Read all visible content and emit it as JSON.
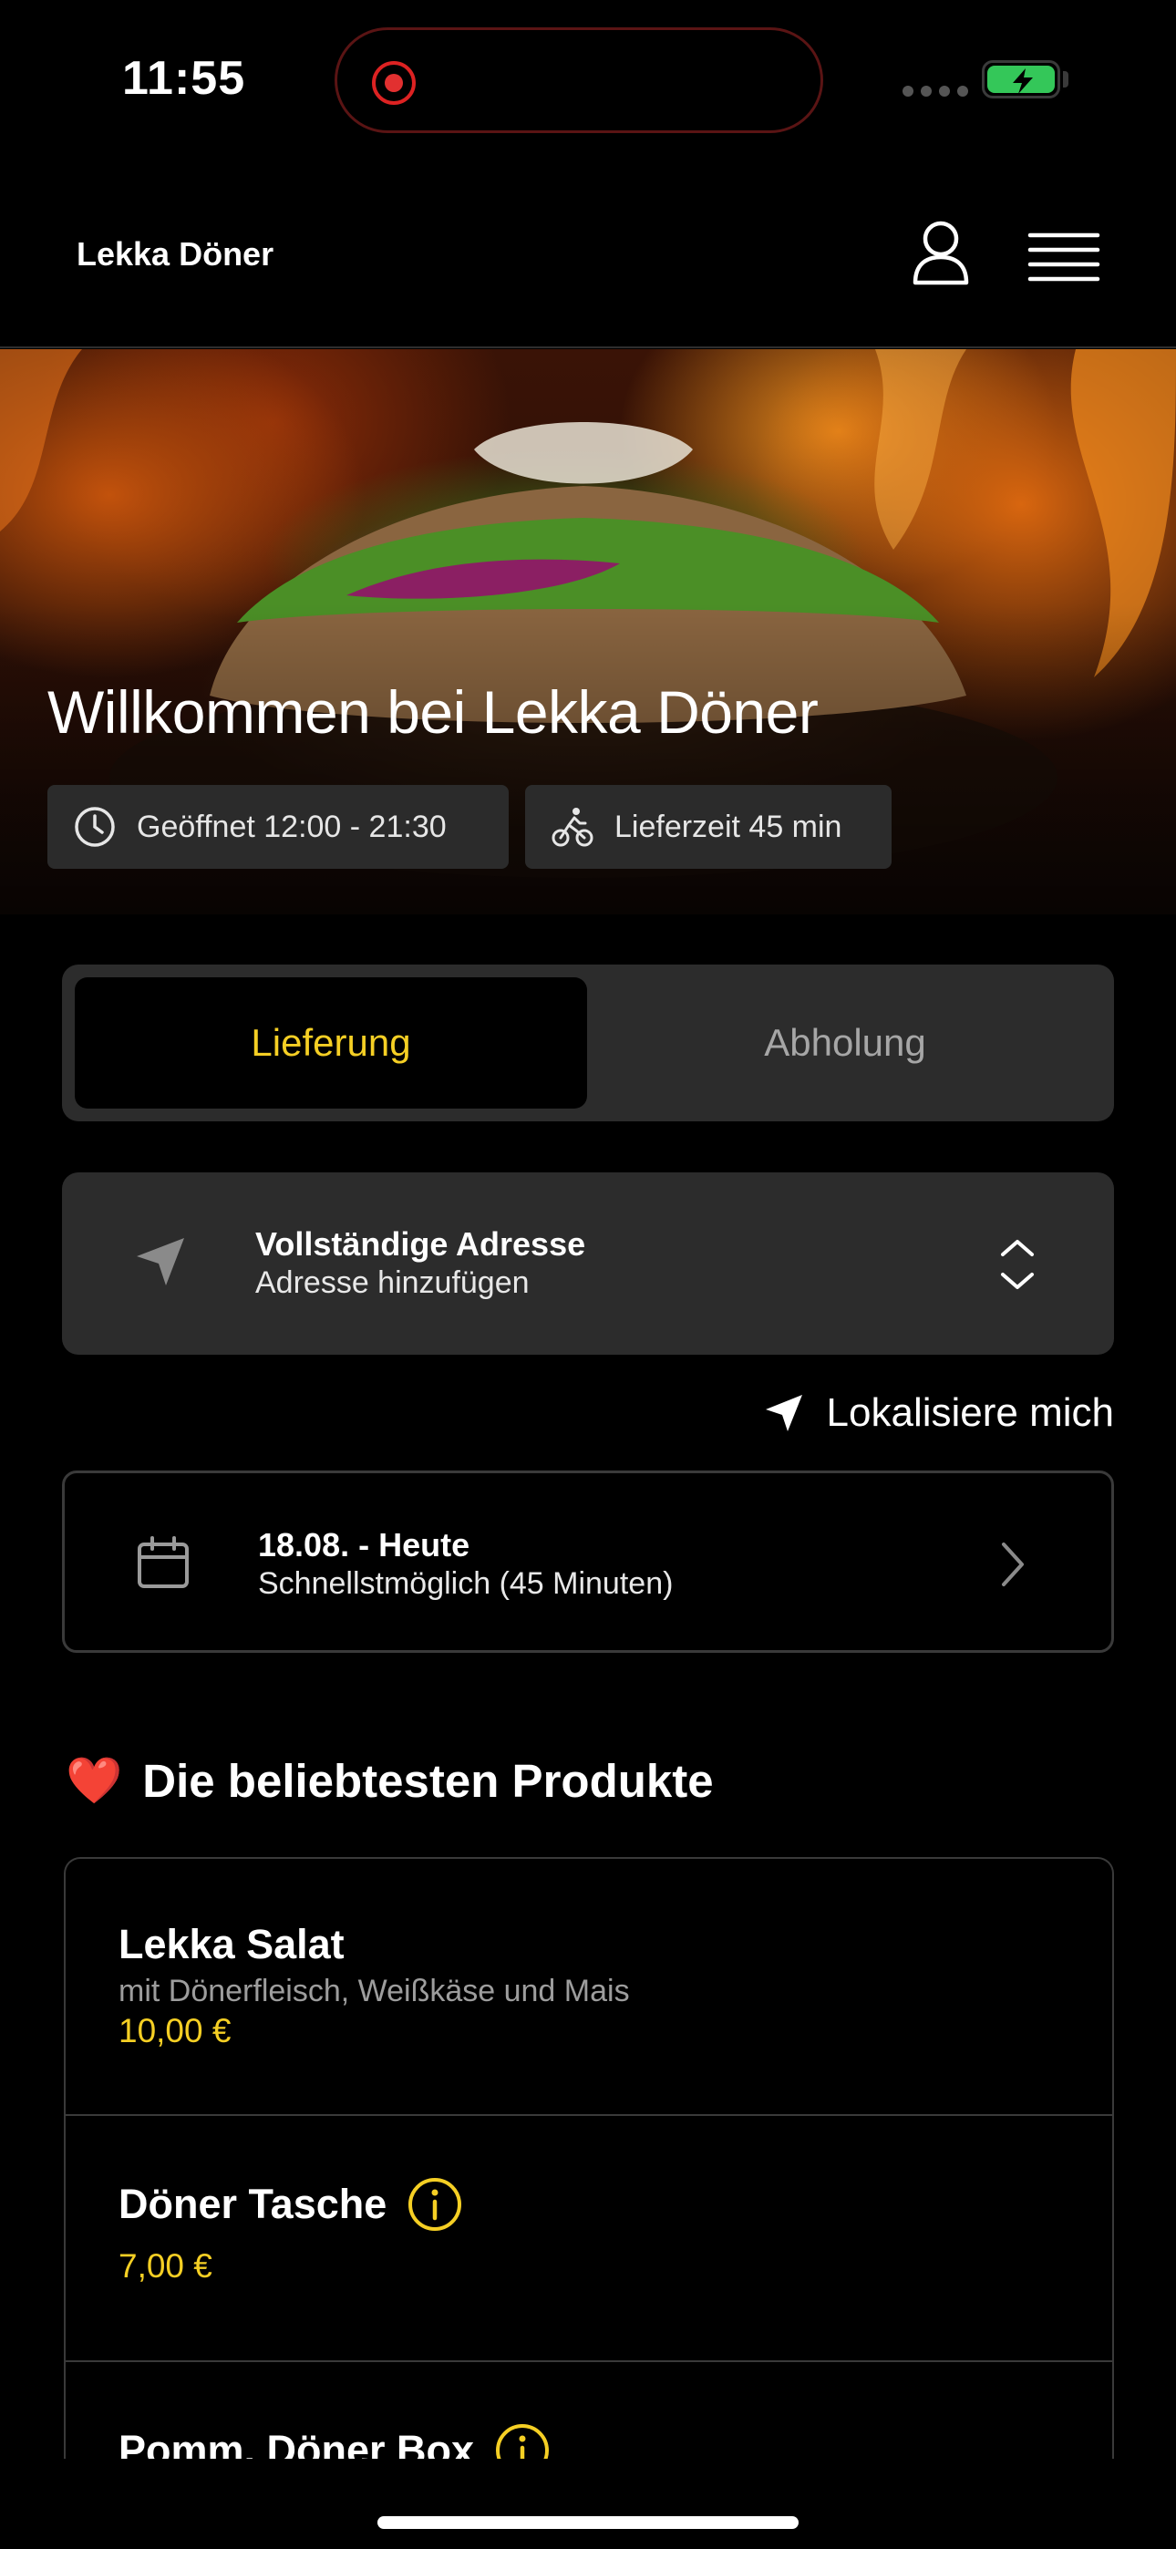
{
  "status_bar": {
    "time": "11:55"
  },
  "header": {
    "brand": "Lekka Döner"
  },
  "hero": {
    "title": "Willkommen bei Lekka Döner",
    "hours_chip": "Geöffnet 12:00 - 21:30",
    "delivery_time_chip": "Lieferzeit 45 min"
  },
  "mode_toggle": {
    "options": [
      "Lieferung",
      "Abholung"
    ],
    "selected": "Lieferung"
  },
  "address": {
    "title": "Vollständige Adresse",
    "subtitle": "Adresse hinzufügen"
  },
  "locate_label": "Lokalisiere mich",
  "schedule": {
    "date": "18.08. - Heute",
    "subtitle": "Schnellstmöglich (45 Minuten)"
  },
  "popular": {
    "heading_emoji": "❤️",
    "heading": "Die beliebtesten Produkte",
    "products": [
      {
        "name": "Lekka Salat",
        "description": "mit Dönerfleisch, Weißkäse und Mais",
        "price": "10,00 €"
      },
      {
        "name": "Döner Tasche",
        "price": "7,00 €"
      },
      {
        "name": "Pomm. Döner Box"
      }
    ]
  },
  "colors": {
    "accent": "#f5cf24",
    "panel": "#2c2c2c",
    "background": "#000000"
  }
}
